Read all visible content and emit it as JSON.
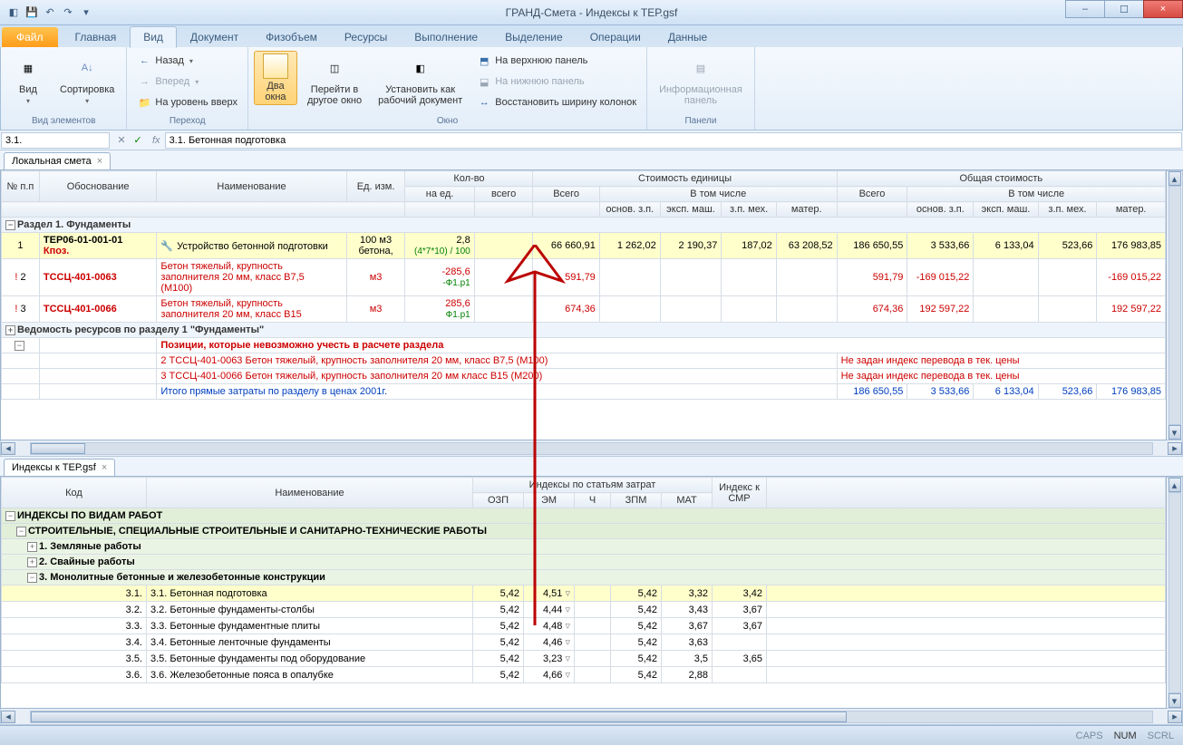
{
  "window": {
    "title": "ГРАНД-Смета - Индексы к ТЕР.gsf",
    "min": "–",
    "max": "☐",
    "close": "×"
  },
  "tabs": {
    "file": "Файл",
    "items": [
      "Главная",
      "Вид",
      "Документ",
      "Физобъем",
      "Ресурсы",
      "Выполнение",
      "Выделение",
      "Операции",
      "Данные"
    ],
    "active_index": 1
  },
  "ribbon": {
    "g_view": {
      "label": "Вид элементов",
      "btn_view": "Вид",
      "btn_sort": "Сортировка"
    },
    "g_nav": {
      "label": "Переход",
      "back": "Назад",
      "fwd": "Вперед",
      "up": "На уровень вверх"
    },
    "g_window": {
      "label": "Окно",
      "two": "Два\nокна",
      "goto": "Перейти в\nдругое окно",
      "setwork": "Установить как\nрабочий документ",
      "top": "На верхнюю панель",
      "bottom": "На нижнюю панель",
      "restore": "Восстановить ширину колонок"
    },
    "g_panels": {
      "label": "Панели",
      "info": "Информационная\nпанель"
    }
  },
  "formula": {
    "cell": "3.1.",
    "value": "3.1. Бетонная подготовка"
  },
  "doc_tabs": {
    "top": "Локальная смета",
    "bottom": "Индексы к ТЕР.gsf"
  },
  "top_headers": {
    "num": "№\nп.п",
    "basis": "Обоснование",
    "name": "Наименование",
    "unit": "Ед. изм.",
    "qty": "Кол-во",
    "qty_unit": "на ед.",
    "qty_total": "всего",
    "unit_cost": "Стоимость единицы",
    "total_cost": "Общая стоимость",
    "total": "Всего",
    "incl": "В том числе",
    "osnzp": "основ. з.п.",
    "eksp": "эксп. маш.",
    "zpmeh": "з.п. мех.",
    "mater": "матер."
  },
  "section1": "Раздел 1. Фундаменты",
  "rows": [
    {
      "n": "1",
      "code": "ТЕР06-01-001-01",
      "kpos": "Кпоз.",
      "name": "Устройство бетонной подготовки",
      "unit": "100 м3\nбетона,",
      "qty_unit": "2,8",
      "qty_formula": "(4*7*10) / 100",
      "total_u": "66 660,91",
      "osn_u": "1 262,02",
      "eksp_u": "2 190,37",
      "zpm_u": "187,02",
      "mat_u": "63 208,52",
      "total": "186 650,55",
      "osn": "3 533,66",
      "eksp": "6 133,04",
      "zpm": "523,66",
      "mat": "176 983,85"
    },
    {
      "n": "2",
      "code": "ТССЦ-401-0063",
      "name": "Бетон тяжелый, крупность\nзаполнителя 20 мм, класс В7,5\n(М100)",
      "unit": "м3",
      "qty_unit": "-285,6",
      "qty_sub": "-Ф1.р1",
      "total_u": "591,79",
      "total": "591,79",
      "osn": "-169 015,22",
      "mat": "-169 015,22",
      "red": true
    },
    {
      "n": "3",
      "code": "ТССЦ-401-0066",
      "name": "Бетон тяжелый, крупность\nзаполнителя 20 мм, класс В15",
      "unit": "м3",
      "qty_unit": "285,6",
      "qty_sub": "Ф1.р1",
      "total_u": "674,36",
      "total": "674,36",
      "osn": "192 597,22",
      "mat": "192 597,22",
      "red": true
    }
  ],
  "vedomost": "Ведомость ресурсов по разделу 1 \"Фундаменты\"",
  "pos_impossible": "Позиции, которые невозможно учесть в расчете раздела",
  "pos_lines": [
    "2 ТССЦ-401-0063 Бетон тяжелый, крупность заполнителя 20 мм, класс В7,5 (М100)",
    "3 ТССЦ-401-0066 Бетон тяжелый, крупность заполнителя 20 мм класс В15 (М200)"
  ],
  "no_index": "Не задан индекс перевода в тек. цены",
  "itogo": "Итого прямые затраты по разделу в ценах 2001г.",
  "itogo_vals": {
    "total": "186 650,55",
    "osn": "3 533,66",
    "eksp": "6 133,04",
    "zpm": "523,66",
    "mat": "176 983,85"
  },
  "idx_headers": {
    "code": "Код",
    "name": "Наименование",
    "group": "Индексы по статьям затрат",
    "smr": "Индекс к\nСМР",
    "ozp": "ОЗП",
    "em": "ЭМ",
    "ch": "Ч",
    "zpm": "ЗПМ",
    "mat": "МАТ"
  },
  "idx_sections": {
    "root": "ИНДЕКСЫ ПО ВИДАМ РАБОТ",
    "cat": "СТРОИТЕЛЬНЫЕ, СПЕЦИАЛЬНЫЕ СТРОИТЕЛЬНЫЕ И САНИТАРНО-ТЕХНИЧЕСКИЕ РАБОТЫ",
    "s1": "1. Земляные работы",
    "s2": "2. Свайные работы",
    "s3": "3. Монолитные бетонные и железобетонные конструкции"
  },
  "idx_rows": [
    {
      "code": "3.1.",
      "name": "3.1. Бетонная подготовка",
      "ozp": "5,42",
      "em": "4,51",
      "ch": "",
      "zpm": "5,42",
      "mat": "3,32",
      "smr": "3,42",
      "hl": true
    },
    {
      "code": "3.2.",
      "name": "3.2. Бетонные фундаменты-столбы",
      "ozp": "5,42",
      "em": "4,44",
      "ch": "",
      "zpm": "5,42",
      "mat": "3,43",
      "smr": "3,67"
    },
    {
      "code": "3.3.",
      "name": "3.3. Бетонные фундаментные плиты",
      "ozp": "5,42",
      "em": "4,48",
      "ch": "",
      "zpm": "5,42",
      "mat": "3,67",
      "smr": "3,67"
    },
    {
      "code": "3.4.",
      "name": "3.4. Бетонные ленточные фундаменты",
      "ozp": "5,42",
      "em": "4,46",
      "ch": "",
      "zpm": "5,42",
      "mat": "3,63",
      "smr": ""
    },
    {
      "code": "3.5.",
      "name": "3.5. Бетонные фундаменты под оборудование",
      "ozp": "5,42",
      "em": "3,23",
      "ch": "",
      "zpm": "5,42",
      "mat": "3,5",
      "smr": "3,65"
    },
    {
      "code": "3.6.",
      "name": "3.6. Железобетонные пояса в опалубке",
      "ozp": "5,42",
      "em": "4,66",
      "ch": "",
      "zpm": "5,42",
      "mat": "2,88",
      "smr": ""
    }
  ],
  "status": {
    "caps": "CAPS",
    "num": "NUM",
    "scrl": "SCRL"
  }
}
